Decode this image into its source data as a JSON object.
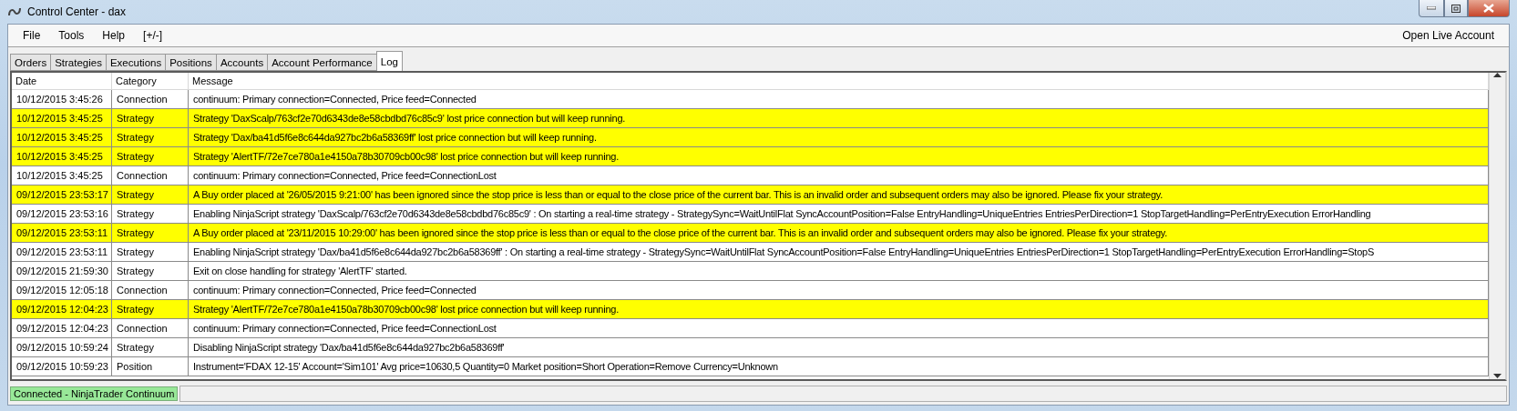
{
  "window": {
    "title": "Control Center - dax"
  },
  "menu": {
    "items": [
      "File",
      "Tools",
      "Help",
      "[+/-]"
    ],
    "right_link": "Open Live Account"
  },
  "tabs": [
    {
      "label": "Orders",
      "selected": false
    },
    {
      "label": "Strategies",
      "selected": false
    },
    {
      "label": "Executions",
      "selected": false
    },
    {
      "label": "Positions",
      "selected": false
    },
    {
      "label": "Accounts",
      "selected": false
    },
    {
      "label": "Account Performance",
      "selected": false
    },
    {
      "label": "Log",
      "selected": true
    }
  ],
  "table": {
    "columns": [
      "Date",
      "Category",
      "Message"
    ],
    "rows": [
      {
        "date": "10/12/2015 3:45:26",
        "category": "Connection",
        "message": "continuum: Primary connection=Connected, Price feed=Connected",
        "highlighted": false
      },
      {
        "date": "10/12/2015 3:45:25",
        "category": "Strategy",
        "message": "Strategy 'DaxScalp/763cf2e70d6343de8e58cbdbd76c85c9' lost price connection but will keep running.",
        "highlighted": true
      },
      {
        "date": "10/12/2015 3:45:25",
        "category": "Strategy",
        "message": "Strategy 'Dax/ba41d5f6e8c644da927bc2b6a58369ff' lost price connection but will keep running.",
        "highlighted": true
      },
      {
        "date": "10/12/2015 3:45:25",
        "category": "Strategy",
        "message": "Strategy 'AlertTF/72e7ce780a1e4150a78b30709cb00c98' lost price connection but will keep running.",
        "highlighted": true
      },
      {
        "date": "10/12/2015 3:45:25",
        "category": "Connection",
        "message": "continuum: Primary connection=Connected, Price feed=ConnectionLost",
        "highlighted": false
      },
      {
        "date": "09/12/2015 23:53:17",
        "category": "Strategy",
        "message": "A Buy order placed at '26/05/2015 9:21:00' has been ignored since the stop price is less than or equal to the close price of the current bar. This is an invalid order and subsequent orders may also be ignored. Please fix your strategy.",
        "highlighted": true
      },
      {
        "date": "09/12/2015 23:53:16",
        "category": "Strategy",
        "message": "Enabling NinjaScript strategy 'DaxScalp/763cf2e70d6343de8e58cbdbd76c85c9' : On starting a real-time strategy - StrategySync=WaitUntilFlat SyncAccountPosition=False EntryHandling=UniqueEntries EntriesPerDirection=1 StopTargetHandling=PerEntryExecution ErrorHandling",
        "highlighted": false
      },
      {
        "date": "09/12/2015 23:53:11",
        "category": "Strategy",
        "message": "A Buy order placed at '23/11/2015 10:29:00' has been ignored since the stop price is less than or equal to the close price of the current bar. This is an invalid order and subsequent orders may also be ignored. Please fix your strategy.",
        "highlighted": true
      },
      {
        "date": "09/12/2015 23:53:11",
        "category": "Strategy",
        "message": "Enabling NinjaScript strategy 'Dax/ba41d5f6e8c644da927bc2b6a58369ff' : On starting a real-time strategy - StrategySync=WaitUntilFlat SyncAccountPosition=False EntryHandling=UniqueEntries EntriesPerDirection=1 StopTargetHandling=PerEntryExecution ErrorHandling=StopS",
        "highlighted": false
      },
      {
        "date": "09/12/2015 21:59:30",
        "category": "Strategy",
        "message": "Exit on close handling for strategy 'AlertTF' started.",
        "highlighted": false
      },
      {
        "date": "09/12/2015 12:05:18",
        "category": "Connection",
        "message": "continuum: Primary connection=Connected, Price feed=Connected",
        "highlighted": false
      },
      {
        "date": "09/12/2015 12:04:23",
        "category": "Strategy",
        "message": "Strategy 'AlertTF/72e7ce780a1e4150a78b30709cb00c98' lost price connection but will keep running.",
        "highlighted": true
      },
      {
        "date": "09/12/2015 12:04:23",
        "category": "Connection",
        "message": "continuum: Primary connection=Connected, Price feed=ConnectionLost",
        "highlighted": false
      },
      {
        "date": "09/12/2015 10:59:24",
        "category": "Strategy",
        "message": "Disabling NinjaScript strategy 'Dax/ba41d5f6e8c644da927bc2b6a58369ff'",
        "highlighted": false
      },
      {
        "date": "09/12/2015 10:59:23",
        "category": "Position",
        "message": "Instrument='FDAX 12-15' Account='Sim101' Avg price=10630,5 Quantity=0 Market position=Short Operation=Remove Currency=Unknown",
        "highlighted": false
      }
    ]
  },
  "status_bar": {
    "text": "Connected - NinjaTrader Continuum"
  }
}
